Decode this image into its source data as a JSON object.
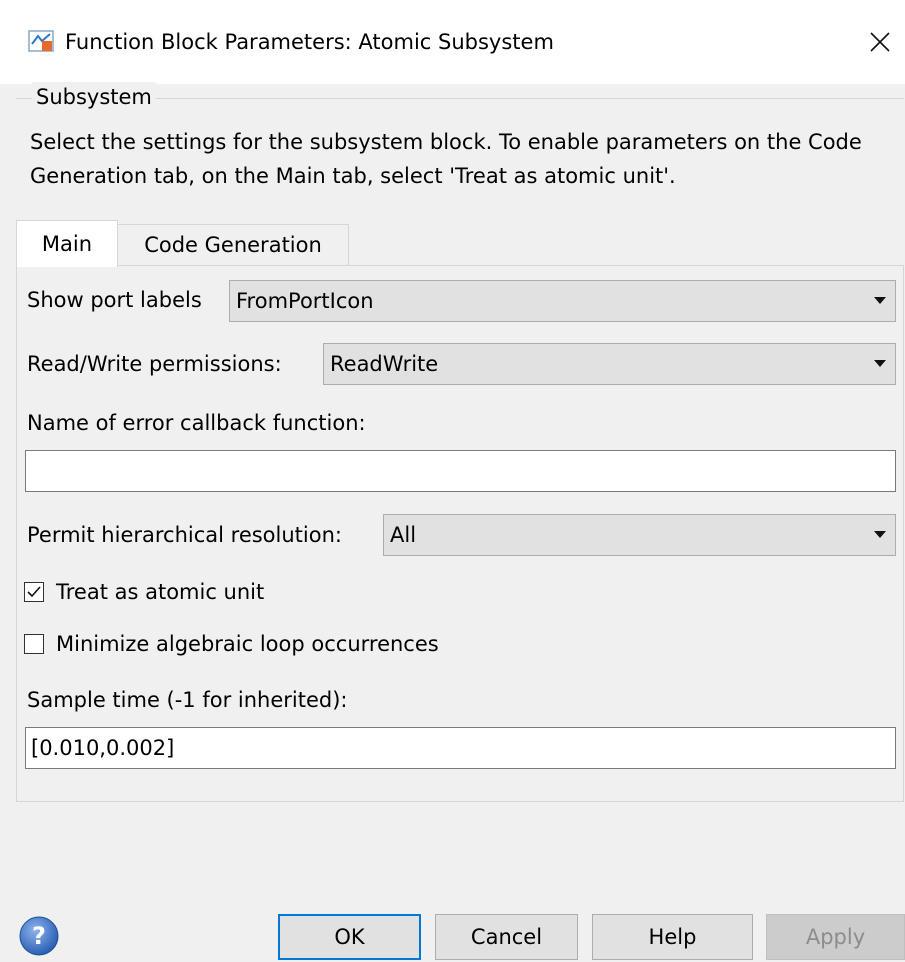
{
  "window": {
    "title": "Function Block Parameters: Atomic Subsystem",
    "icons": {
      "app": "simulink-block-icon",
      "close": "close-icon"
    }
  },
  "group": {
    "legend": "Subsystem",
    "description": "Select the settings for the subsystem block. To enable parameters on the Code Generation tab, on the Main tab, select 'Treat as atomic unit'."
  },
  "tabs": [
    {
      "label": "Main",
      "selected": true
    },
    {
      "label": "Code Generation",
      "selected": false
    }
  ],
  "main": {
    "show_port_labels": {
      "label": "Show port labels",
      "value": "FromPortIcon"
    },
    "read_write": {
      "label": "Read/Write permissions:",
      "value": "ReadWrite"
    },
    "error_callback": {
      "label": "Name of error callback function:",
      "value": ""
    },
    "hier_resolution": {
      "label": "Permit hierarchical resolution:",
      "value": "All"
    },
    "treat_atomic": {
      "label": "Treat as atomic unit",
      "checked": true
    },
    "minimize_loop": {
      "label": "Minimize algebraic loop occurrences",
      "checked": false
    },
    "sample_time": {
      "label": "Sample time (-1 for inherited):",
      "value": "[0.010,0.002]"
    }
  },
  "buttons": {
    "ok": "OK",
    "cancel": "Cancel",
    "help": "Help",
    "apply": "Apply",
    "apply_enabled": false
  },
  "colors": {
    "focus_border": "#0078d7",
    "help_icon": "#3b6fc4"
  }
}
